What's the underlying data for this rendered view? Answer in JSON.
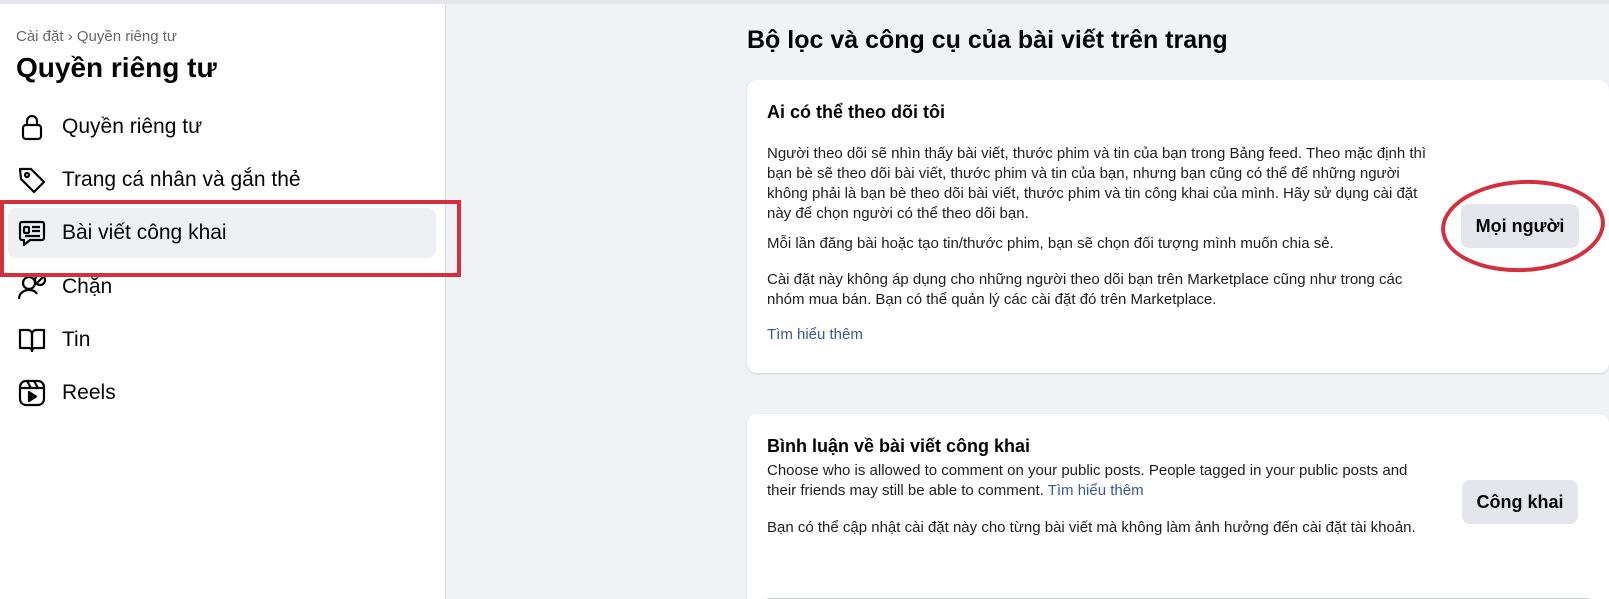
{
  "sidebar": {
    "breadcrumb": "Cài đặt › Quyền riêng tư",
    "title": "Quyền riêng tư",
    "items": [
      {
        "label": "Quyền riêng tư",
        "icon": "lock-icon"
      },
      {
        "label": "Trang cá nhân và gắn thẻ",
        "icon": "tag-icon"
      },
      {
        "label": "Bài viết công khai",
        "icon": "public-post-icon",
        "active": true
      },
      {
        "label": "Chặn",
        "icon": "block-user-icon"
      },
      {
        "label": "Tin",
        "icon": "book-icon"
      },
      {
        "label": "Reels",
        "icon": "reels-icon"
      }
    ]
  },
  "main": {
    "heading": "Bộ lọc và công cụ của bài viết trên trang",
    "follow_card": {
      "title": "Ai có thể theo dõi tôi",
      "paragraph_1": "Người theo dõi sẽ nhìn thấy bài viết, thước phim và tin của bạn trong Bảng feed. Theo mặc định thì bạn bè sẽ theo dõi bài viết, thước phim và tin của bạn, nhưng bạn cũng có thể để những người không phải là bạn bè theo dõi bài viết, thước phim và tin công khai của mình. Hãy sử dụng cài đặt này để chọn người có thể theo dõi bạn.",
      "paragraph_2": "Mỗi lần đăng bài hoặc tạo tin/thước phim, bạn sẽ chọn đối tượng mình muốn chia sẻ.",
      "paragraph_3": "Cài đặt này không áp dụng cho những người theo dõi bạn trên Marketplace cũng như trong các nhóm mua bán. Bạn có thể quản lý các cài đặt đó trên Marketplace.",
      "learn_more": "Tìm hiểu thêm",
      "button_label": "Mọi người"
    },
    "comments_card": {
      "title": "Bình luận về bài viết công khai",
      "paragraph_1": "Choose who is allowed to comment on your public posts. People tagged in your public posts and their friends may still be able to comment.",
      "learn_more": "Tìm hiểu thêm",
      "paragraph_2": "Bạn có thể cập nhật cài đặt này cho từng bài viết mà không làm ảnh hưởng đến cài đặt tài khoản.",
      "button_label": "Công khai"
    }
  },
  "colors": {
    "annotation_red": "#d32f3c",
    "link": "#385898",
    "active_bg": "#eef0f3"
  }
}
